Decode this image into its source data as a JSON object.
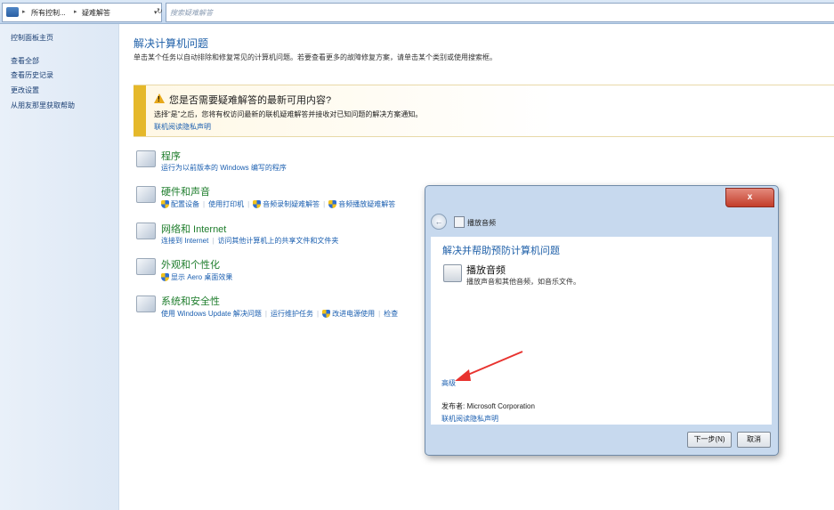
{
  "address_bar": {
    "crumbs": [
      "所有控制...",
      "疑难解答"
    ],
    "search_placeholder": "搜索疑难解答"
  },
  "left_pane": {
    "links": [
      "控制面板主页",
      "查看全部",
      "查看历史记录",
      "更改设置",
      "从朋友那里获取帮助"
    ]
  },
  "main": {
    "title": "解决计算机问题",
    "subtitle": "单击某个任务以自动排除和修复常见的计算机问题。若要查看更多的故障修复方案，请单击某个类别或使用搜索框。",
    "banner": {
      "title": "您是否需要疑难解答的最新可用内容?",
      "text": "选择“是”之后，您将有权访问最新的联机疑难解答并接收对已知问题的解决方案通知。",
      "link": "联机阅读隐私声明"
    },
    "categories": [
      {
        "title": "程序",
        "links": [
          "运行为以前版本的 Windows 编写的程序"
        ]
      },
      {
        "title": "硬件和声音",
        "links": [
          "配置设备",
          "使用打印机",
          "音频录制疑难解答",
          "音频播放疑难解答"
        ]
      },
      {
        "title": "网络和 Internet",
        "links": [
          "连接到 Internet",
          "访问其他计算机上的共享文件和文件夹"
        ]
      },
      {
        "title": "外观和个性化",
        "links": [
          "显示 Aero 桌面效果"
        ]
      },
      {
        "title": "系统和安全性",
        "links": [
          "使用 Windows Update 解决问题",
          "运行维护任务",
          "改进电源使用",
          "检查"
        ]
      }
    ]
  },
  "dialog": {
    "close_label": "x",
    "nav_title": "播放音频",
    "heading": "解决并帮助预防计算机问题",
    "item_title": "播放音频",
    "item_desc": "播放声音和其他音频，如音乐文件。",
    "advanced_link": "高级",
    "publisher_label": "发布者:",
    "publisher_value": "Microsoft Corporation",
    "privacy_link": "联机阅读隐私声明",
    "next_button": "下一步(N)",
    "cancel_button": "取消"
  },
  "colors": {
    "link_blue": "#1b5fb0",
    "category_green": "#1e7d2c",
    "title_blue": "#1e5fa8",
    "banner_yellow": "#e5b82a",
    "close_red": "#c33d2a",
    "annotation_arrow": "#e8332f"
  }
}
